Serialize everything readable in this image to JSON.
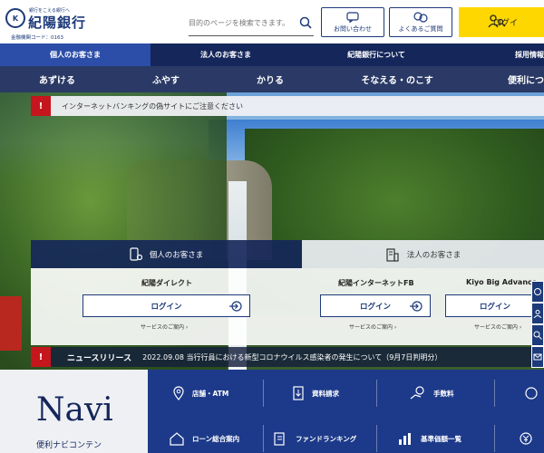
{
  "header": {
    "logo": {
      "tagline": "銀行をこえる銀行へ",
      "name": "紀陽銀行",
      "code": "金融機関コード：0163"
    },
    "search": {
      "placeholder": "目的のページを検索できます。"
    },
    "contact_label": "お問い合わせ",
    "faq_label": "よくあるご質問",
    "login_label": "ログイ"
  },
  "nav_primary": [
    {
      "label": "個人のお客さま",
      "active": true
    },
    {
      "label": "法人のお客さま",
      "active": false
    },
    {
      "label": "紀陽銀行について",
      "active": false
    },
    {
      "label": "採用情報",
      "active": false
    }
  ],
  "nav_secondary": [
    {
      "label": "あずける"
    },
    {
      "label": "ふやす"
    },
    {
      "label": "かりる"
    },
    {
      "label": "そなえる・のこす"
    },
    {
      "label": "便利につ"
    }
  ],
  "alert": {
    "mark": "!",
    "text": "インターネットバンキングの偽サイトにご注意ください"
  },
  "login_panel": {
    "personal_tab": "個人のお客さま",
    "corporate_tab": "法人のお客さま",
    "services": [
      {
        "title": "紀陽ダイレクト",
        "button": "ログイン",
        "guide": "サービスのご案内"
      },
      {
        "title": "紀陽インターネットFB",
        "button": "ログイン",
        "guide": "サービスのご案内"
      },
      {
        "title": "Kiyo Big Advance",
        "button": "ログイン",
        "guide": "サービスのご案内"
      }
    ]
  },
  "news": {
    "mark": "!",
    "label": "ニュースリリース",
    "text": "2022.09.08 当行行員における新型コロナウイルス感染者の発生について（9月7日判明分）"
  },
  "navi": {
    "title": "Navi",
    "subtitle": "便利ナビコンテン",
    "items": [
      {
        "label": "店舗・ATM",
        "icon": "map-pin-icon"
      },
      {
        "label": "資料請求",
        "icon": "document-download-icon"
      },
      {
        "label": "手数料",
        "icon": "hand-coin-icon"
      },
      {
        "label": "",
        "icon": "exchange-icon"
      },
      {
        "label": "ローン総合案内",
        "icon": "house-yen-icon"
      },
      {
        "label": "ファンドランキング",
        "icon": "ranking-icon"
      },
      {
        "label": "基準価額一覧",
        "icon": "bar-chart-icon"
      },
      {
        "label": "",
        "icon": "yen-cycle-icon"
      }
    ]
  },
  "colors": {
    "navy": "#14265a",
    "accent_blue": "#1d3a8a",
    "login_yellow": "#ffd700",
    "alert_red": "#c4161c"
  }
}
